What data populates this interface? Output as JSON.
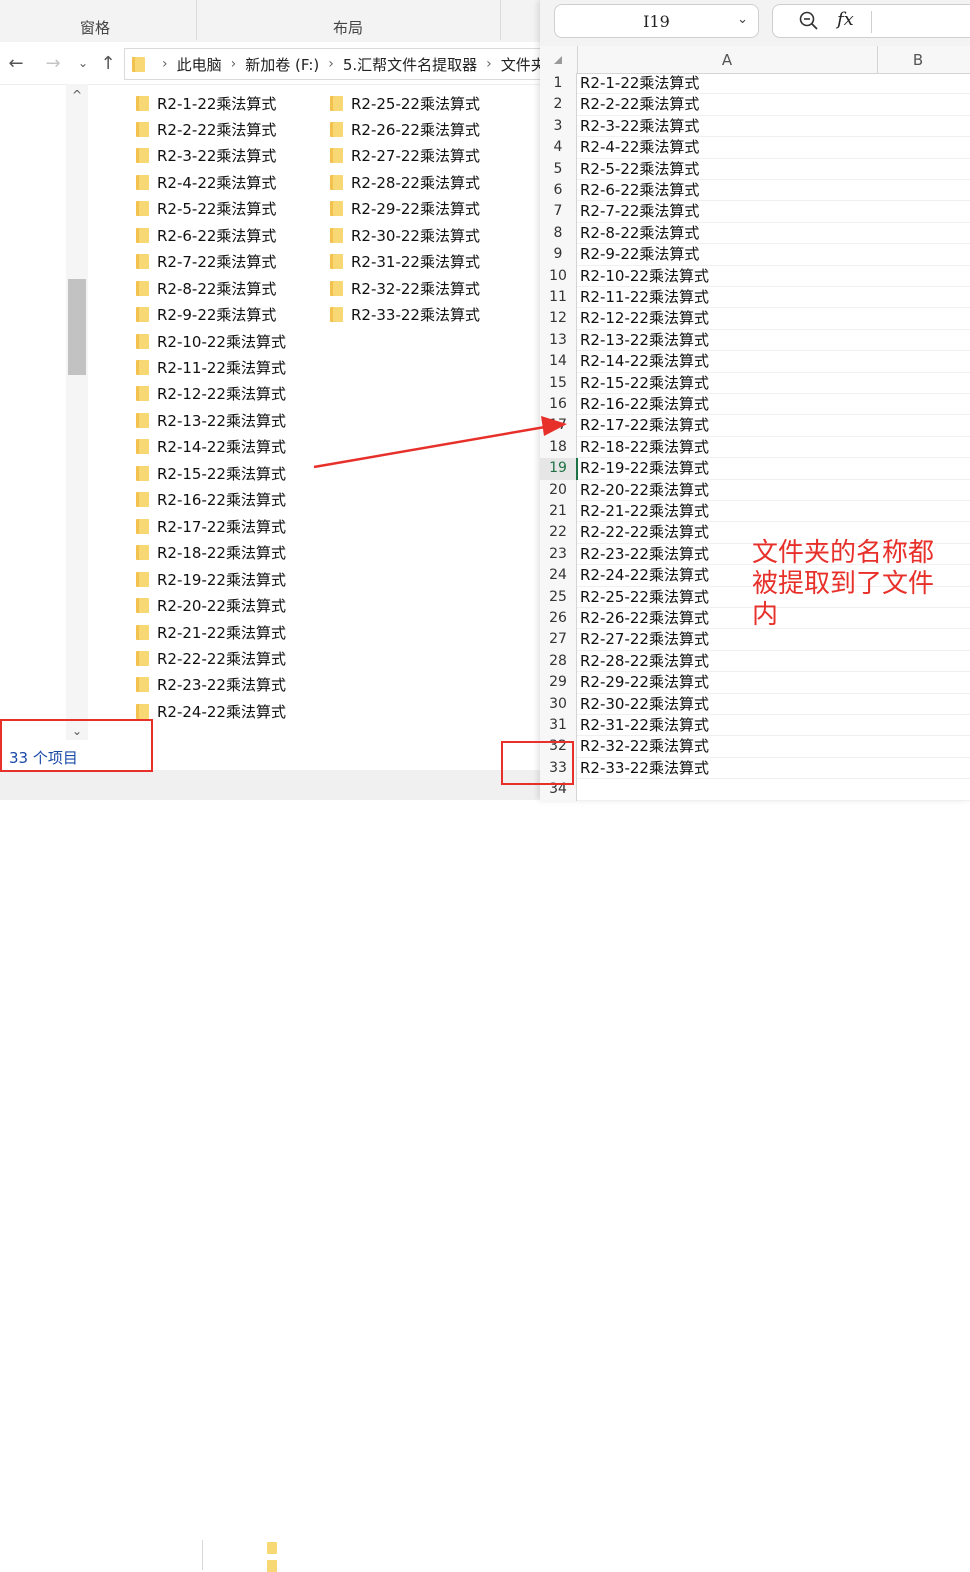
{
  "explorer": {
    "ribbon": {
      "group_window": "窗格",
      "group_layout": "布局"
    },
    "breadcrumb": [
      "此电脑",
      "新加卷 (F:)",
      "5.汇帮文件名提取器",
      "文件夹"
    ],
    "folders": [
      "R2-1-22乘法算式",
      "R2-2-22乘法算式",
      "R2-3-22乘法算式",
      "R2-4-22乘法算式",
      "R2-5-22乘法算式",
      "R2-6-22乘法算式",
      "R2-7-22乘法算式",
      "R2-8-22乘法算式",
      "R2-9-22乘法算式",
      "R2-10-22乘法算式",
      "R2-11-22乘法算式",
      "R2-12-22乘法算式",
      "R2-13-22乘法算式",
      "R2-14-22乘法算式",
      "R2-15-22乘法算式",
      "R2-16-22乘法算式",
      "R2-17-22乘法算式",
      "R2-18-22乘法算式",
      "R2-19-22乘法算式",
      "R2-20-22乘法算式",
      "R2-21-22乘法算式",
      "R2-22-22乘法算式",
      "R2-23-22乘法算式",
      "R2-24-22乘法算式",
      "R2-25-22乘法算式",
      "R2-26-22乘法算式",
      "R2-27-22乘法算式",
      "R2-28-22乘法算式",
      "R2-29-22乘法算式",
      "R2-30-22乘法算式",
      "R2-31-22乘法算式",
      "R2-32-22乘法算式",
      "R2-33-22乘法算式"
    ],
    "status": "33 个项目"
  },
  "sheet": {
    "name_box": "I19",
    "fx_label": "fx",
    "columns": [
      "A",
      "B"
    ],
    "active_row": 19,
    "rows": [
      {
        "num": "1",
        "a": "R2-1-22乘法算式"
      },
      {
        "num": "2",
        "a": "R2-2-22乘法算式"
      },
      {
        "num": "3",
        "a": "R2-3-22乘法算式"
      },
      {
        "num": "4",
        "a": "R2-4-22乘法算式"
      },
      {
        "num": "5",
        "a": "R2-5-22乘法算式"
      },
      {
        "num": "6",
        "a": "R2-6-22乘法算式"
      },
      {
        "num": "7",
        "a": "R2-7-22乘法算式"
      },
      {
        "num": "8",
        "a": "R2-8-22乘法算式"
      },
      {
        "num": "9",
        "a": "R2-9-22乘法算式"
      },
      {
        "num": "10",
        "a": "R2-10-22乘法算式"
      },
      {
        "num": "11",
        "a": "R2-11-22乘法算式"
      },
      {
        "num": "12",
        "a": "R2-12-22乘法算式"
      },
      {
        "num": "13",
        "a": "R2-13-22乘法算式"
      },
      {
        "num": "14",
        "a": "R2-14-22乘法算式"
      },
      {
        "num": "15",
        "a": "R2-15-22乘法算式"
      },
      {
        "num": "16",
        "a": "R2-16-22乘法算式"
      },
      {
        "num": "17",
        "a": "R2-17-22乘法算式"
      },
      {
        "num": "18",
        "a": "R2-18-22乘法算式"
      },
      {
        "num": "19",
        "a": "R2-19-22乘法算式"
      },
      {
        "num": "20",
        "a": "R2-20-22乘法算式"
      },
      {
        "num": "21",
        "a": "R2-21-22乘法算式"
      },
      {
        "num": "22",
        "a": "R2-22-22乘法算式"
      },
      {
        "num": "23",
        "a": "R2-23-22乘法算式"
      },
      {
        "num": "24",
        "a": "R2-24-22乘法算式"
      },
      {
        "num": "25",
        "a": "R2-25-22乘法算式"
      },
      {
        "num": "26",
        "a": "R2-26-22乘法算式"
      },
      {
        "num": "27",
        "a": "R2-27-22乘法算式"
      },
      {
        "num": "28",
        "a": "R2-28-22乘法算式"
      },
      {
        "num": "29",
        "a": "R2-29-22乘法算式"
      },
      {
        "num": "30",
        "a": "R2-30-22乘法算式"
      },
      {
        "num": "31",
        "a": "R2-31-22乘法算式"
      },
      {
        "num": "32",
        "a": "R2-32-22乘法算式"
      },
      {
        "num": "33",
        "a": "R2-33-22乘法算式"
      },
      {
        "num": "34",
        "a": ""
      }
    ]
  },
  "annotation": {
    "lines": [
      "文件夹的名称都",
      "被提取到了文件",
      "内"
    ],
    "color": "#e8302a"
  },
  "icons": {
    "back": "back-arrow-icon",
    "forward": "forward-arrow-icon",
    "recent": "chevron-down-icon",
    "up": "up-arrow-icon",
    "folder": "folder-icon",
    "zoom": "zoom-out-icon",
    "fx": "function-icon"
  }
}
